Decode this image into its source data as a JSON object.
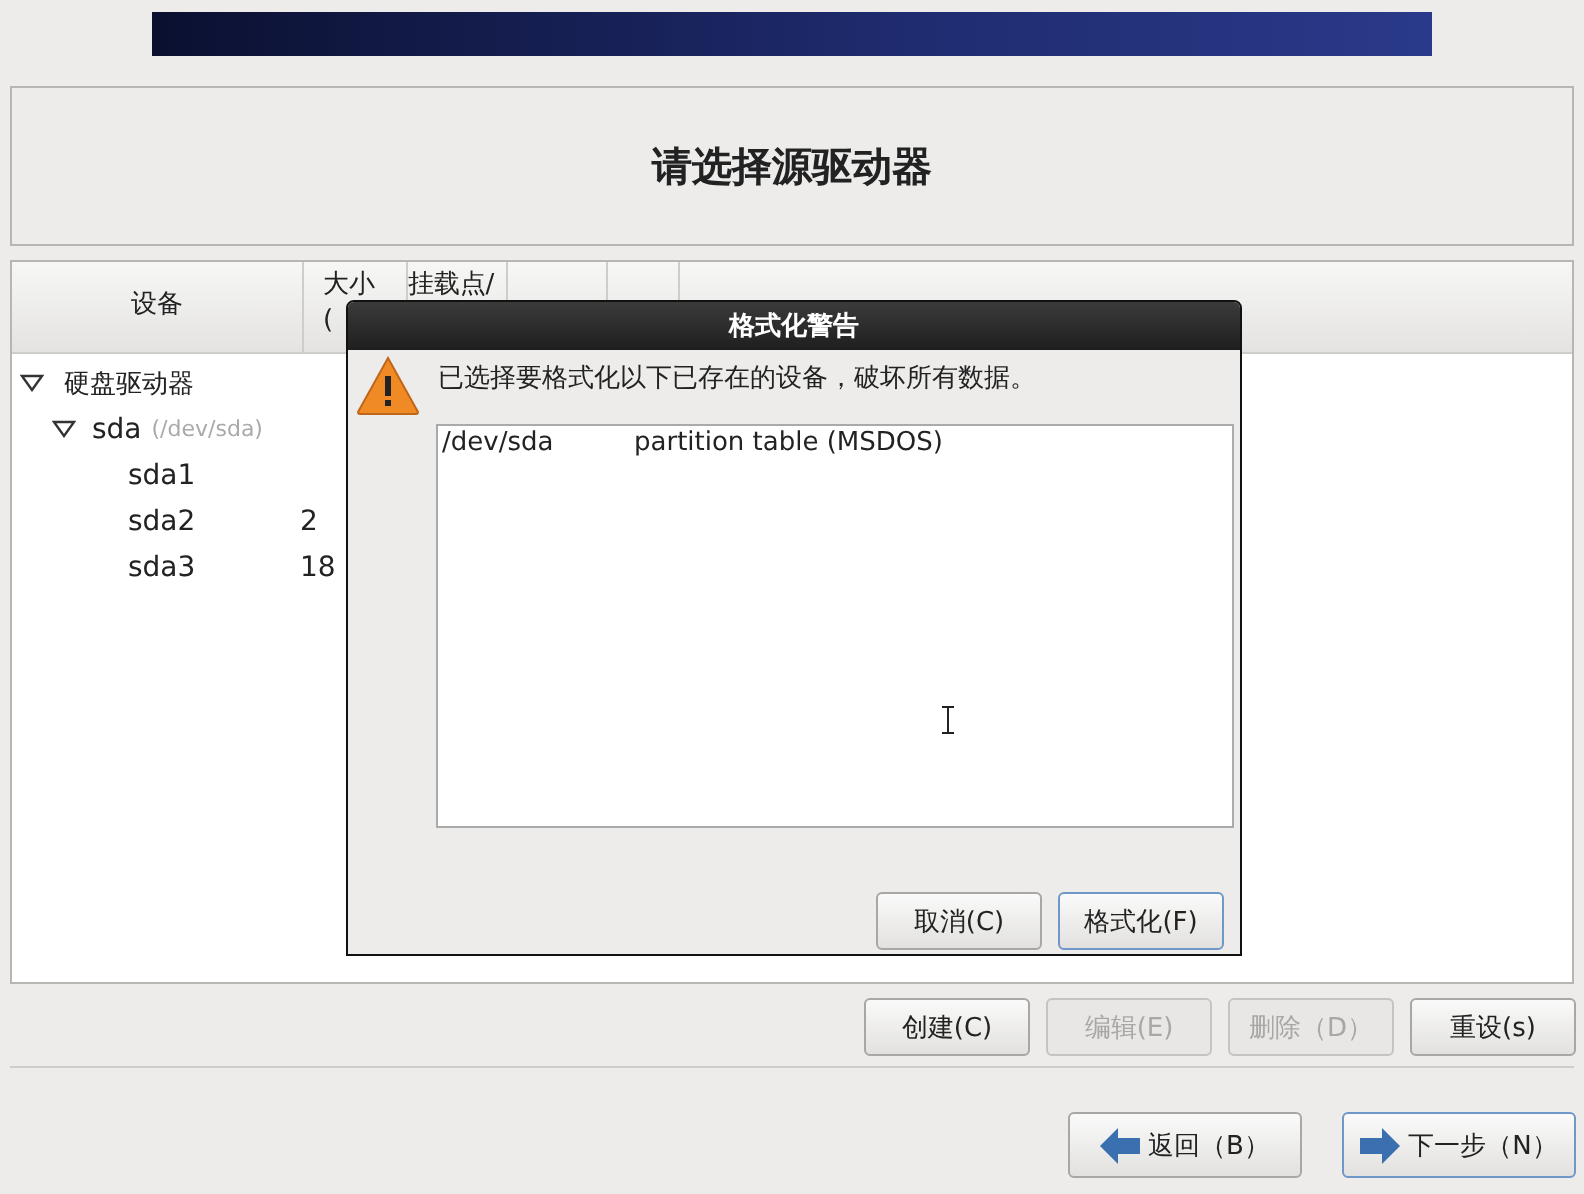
{
  "page_title": "请选择源驱动器",
  "table": {
    "columns": [
      {
        "label": "设备"
      },
      {
        "label": "大小\n("
      },
      {
        "label": "挂载点/"
      },
      {},
      {}
    ],
    "tree": [
      {
        "name": "硬盘驱动器",
        "expanded": true,
        "children": [
          {
            "name": "sda",
            "path": "(/dev/sda)",
            "expanded": true,
            "children": [
              {
                "name": "sda1"
              },
              {
                "name": "sda2",
                "size": "2"
              },
              {
                "name": "sda3",
                "size": "18"
              }
            ]
          }
        ]
      }
    ]
  },
  "dialog": {
    "title": "格式化警告",
    "message": "已选择要格式化以下已存在的设备，破坏所有数据。",
    "items": [
      {
        "device": "/dev/sda",
        "description": "partition table (MSDOS)"
      }
    ],
    "buttons": [
      {
        "label": "取消(C)",
        "focused": false
      },
      {
        "label": "格式化(F)",
        "focused": true
      }
    ]
  },
  "actions": [
    {
      "label": "创建(C)",
      "disabled": false
    },
    {
      "label": "编辑(E)",
      "disabled": true
    },
    {
      "label": "删除（D）",
      "disabled": true
    },
    {
      "label": "重设(s)",
      "disabled": false
    }
  ],
  "nav": [
    {
      "label": "返回（B）",
      "kind": "back",
      "focused": false
    },
    {
      "label": "下一步（N）",
      "kind": "next",
      "focused": true
    }
  ]
}
